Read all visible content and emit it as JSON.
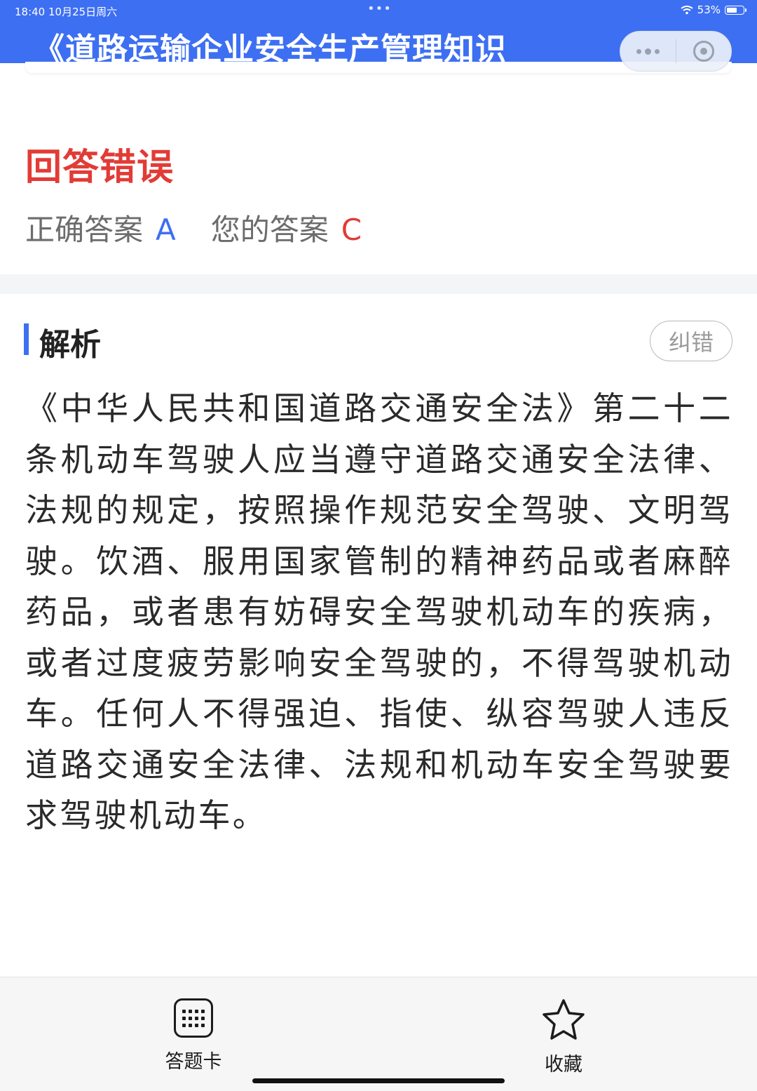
{
  "status_bar": {
    "time_date": "18:40   10月25日周六",
    "center_dots": "•••",
    "battery_percent": "53%",
    "battery_level": 0.53
  },
  "header": {
    "title": "《道路运输企业安全生产管理知识"
  },
  "result": {
    "title": "回答错误",
    "correct_label": "正确答案",
    "correct_value": "A",
    "your_label": "您的答案",
    "your_value": "C"
  },
  "analysis": {
    "title": "解析",
    "report_button": "纠错",
    "text": "《中华人民共和国道路交通安全法》第二十二条机动车驾驶人应当遵守道路交通安全法律、法规的规定，按照操作规范安全驾驶、文明驾驶。饮酒、服用国家管制的精神药品或者麻醉药品，或者患有妨碍安全驾驶机动车的疾病，或者过度疲劳影响安全驾驶的，不得驾驶机动车。任何人不得强迫、指使、纵容驾驶人违反道路交通安全法律、法规和机动车安全驾驶要求驾驶机动车。"
  },
  "bottom_nav": {
    "answer_card_label": "答题卡",
    "favorite_label": "收藏"
  },
  "colors": {
    "header_blue": "#3d6ff2",
    "error_red": "#e23b36",
    "correct_blue": "#3d6ff2"
  },
  "icons": [
    "wifi-icon",
    "battery-icon",
    "more-icon",
    "target-icon",
    "grid-icon",
    "star-icon"
  ]
}
